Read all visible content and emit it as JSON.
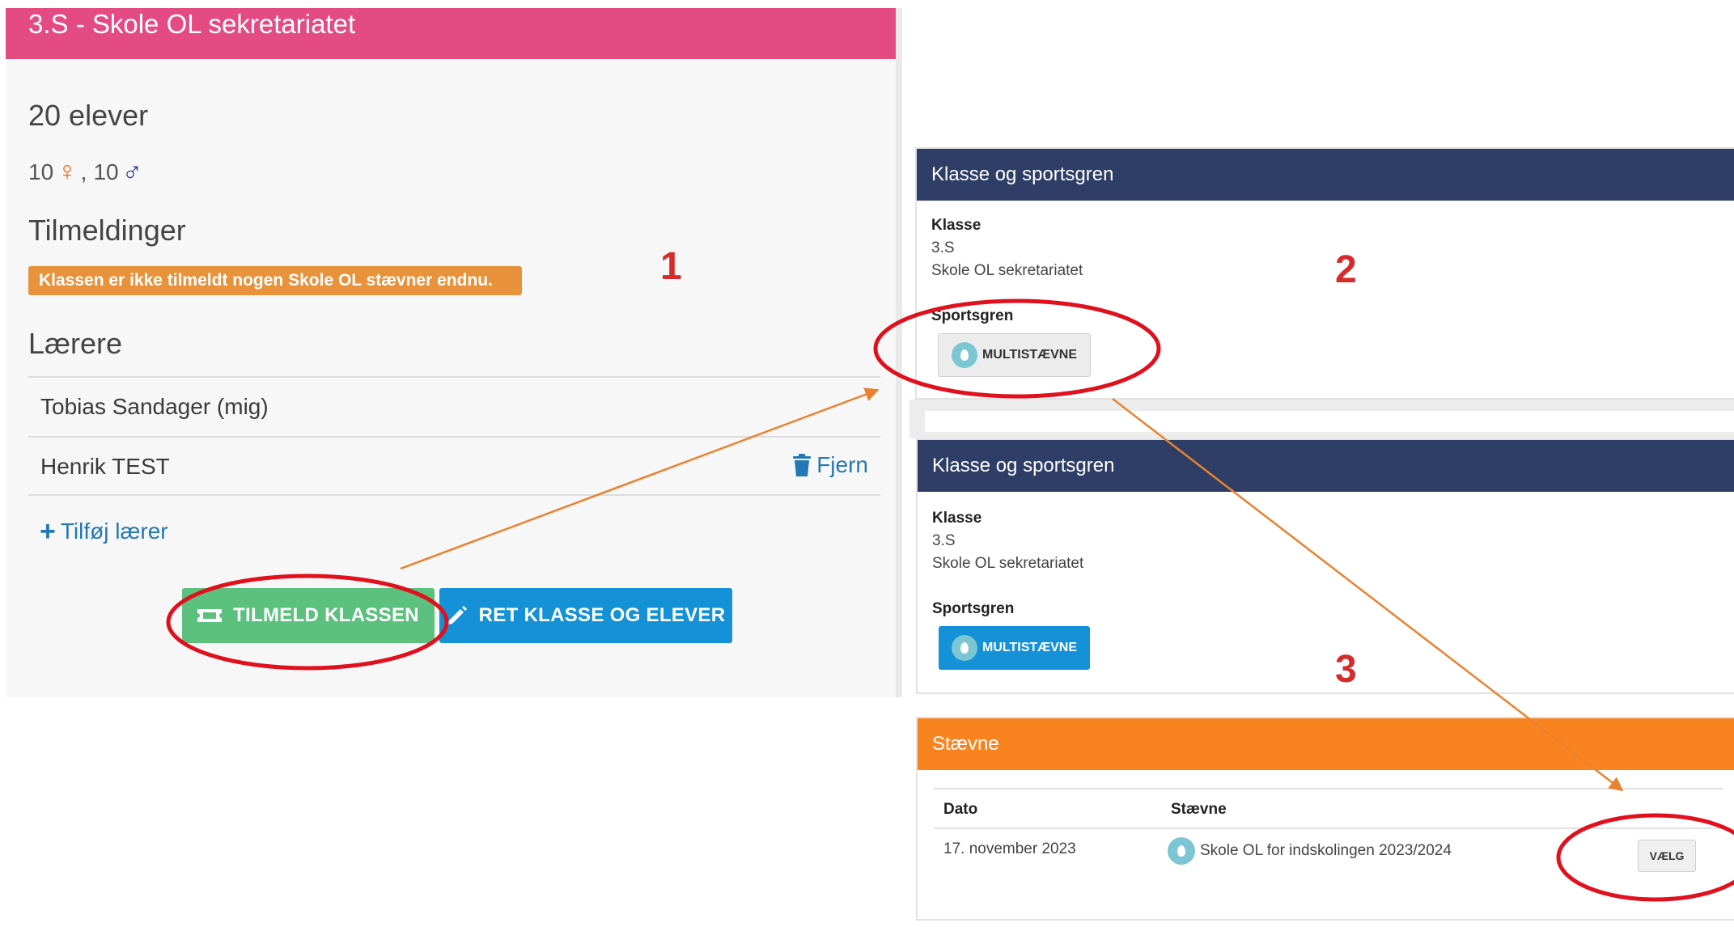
{
  "panel1": {
    "title": "3.S - Skole OL sekretariatet",
    "students": "20 elever",
    "female_count": "10",
    "male_count": "10",
    "separator": ",",
    "female_symbol": "♀",
    "male_symbol": "♂",
    "registrations_heading": "Tilmeldinger",
    "registrations_alert": "Klassen er ikke tilmeldt nogen Skole OL stævner endnu.",
    "teachers_heading": "Lærere",
    "teachers": [
      {
        "name": "Tobias Sandager (mig)"
      },
      {
        "name": "Henrik TEST",
        "remove_label": "Fjern"
      }
    ],
    "add_teacher_label": "Tilføj lærer",
    "register_button": "TILMELD KLASSEN",
    "edit_button": "RET KLASSE OG ELEVER"
  },
  "panel2": {
    "header": "Klasse og sportsgren",
    "class_label": "Klasse",
    "class_value": "3.S",
    "school_value": "Skole OL sekretariatet",
    "sport_label": "Sportsgren",
    "sport_button": "MULTISTÆVNE"
  },
  "panel3": {
    "header": "Klasse og sportsgren",
    "class_label": "Klasse",
    "class_value": "3.S",
    "school_value": "Skole OL sekretariatet",
    "sport_label": "Sportsgren",
    "sport_button": "MULTISTÆVNE"
  },
  "panel4": {
    "header": "Stævne",
    "columns": [
      "Dato",
      "Stævne"
    ],
    "rows": [
      {
        "date": "17. november 2023",
        "event": "Skole OL for indskolingen 2023/2024",
        "action": "VÆLG"
      }
    ]
  },
  "annotations": {
    "steps": [
      "1",
      "2",
      "3"
    ],
    "highlight_color": "#e0101d",
    "arrow_color": "#e8822e"
  },
  "colors": {
    "pink_header": "#e44b83",
    "navy_header": "#2e3e66",
    "orange_header": "#f9831f",
    "green_button": "#5cc07e",
    "blue_button": "#1491d7",
    "alert_orange": "#e8923b"
  },
  "icons": [
    "female-icon",
    "male-icon",
    "trash-icon",
    "plus-icon",
    "ticket-icon",
    "pencil-icon",
    "sport-logo-icon"
  ]
}
